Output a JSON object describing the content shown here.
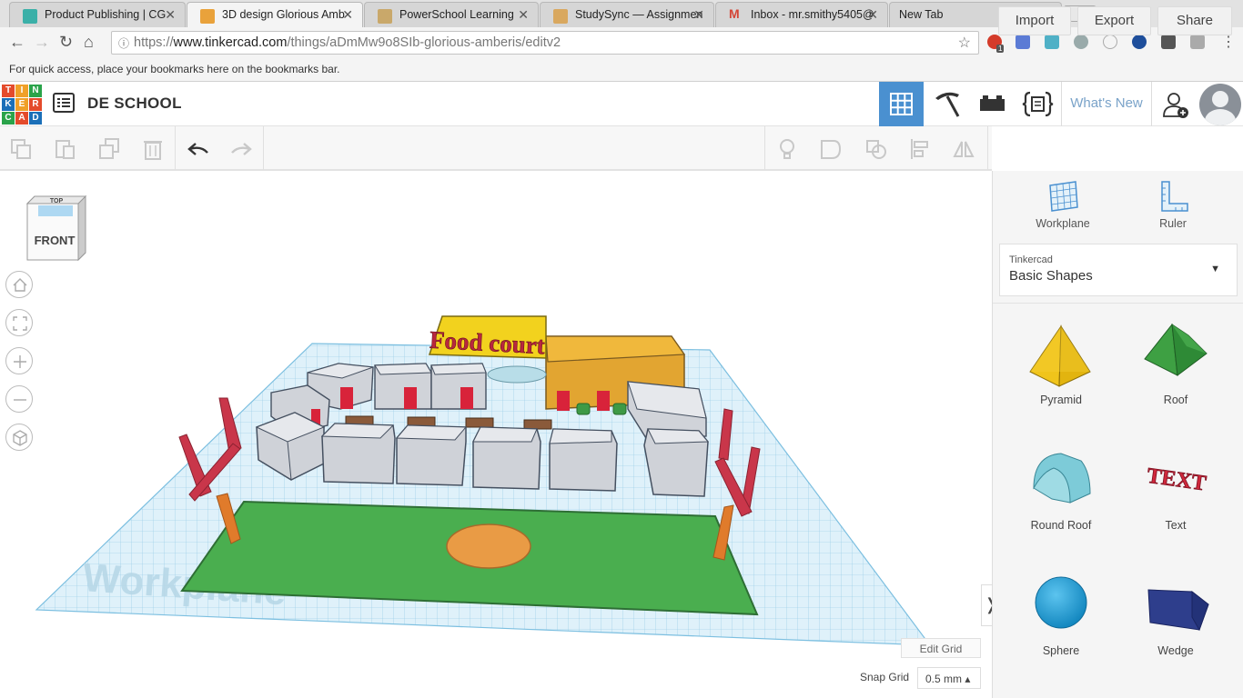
{
  "browser": {
    "tabs": [
      {
        "title": "Product Publishing | CG",
        "favicon_color": "#3bb0a8",
        "active": false
      },
      {
        "title": "3D design Glorious Amb",
        "favicon_color": "#e9a23b",
        "active": true
      },
      {
        "title": "PowerSchool Learning",
        "favicon_color": "#c9a86a",
        "active": false
      },
      {
        "title": "StudySync — Assignmen",
        "favicon_color": "#d9a85f",
        "active": false
      },
      {
        "title": "Inbox - mr.smithy5405@",
        "favicon_color": "#d44638",
        "active": false
      },
      {
        "title": "New Tab",
        "favicon_color": "",
        "active": false
      }
    ],
    "url_prefix": "https://",
    "url_host": "www.tinkercad.com",
    "url_path": "/things/aDmMw9o8SIb-glorious-amberis/editv2",
    "bookmarks_hint": "For quick access, place your bookmarks here on the bookmarks bar.",
    "extension_badge": "1"
  },
  "header": {
    "logo_letters": [
      "T",
      "I",
      "N",
      "K",
      "E",
      "R",
      "C",
      "A",
      "D"
    ],
    "logo_colors": [
      "#e44b2c",
      "#f0a028",
      "#2aa34a",
      "#1b6fb8",
      "#f0a028",
      "#e44b2c",
      "#2aa34a",
      "#e44b2c",
      "#1b6fb8"
    ],
    "project_title": "DE SCHOOL",
    "whats_new": "What's New",
    "accent": "#4a90d0"
  },
  "toolbar": {
    "import": "Import",
    "export": "Export",
    "share": "Share"
  },
  "viewcube": {
    "top": "TOP",
    "front": "FRONT"
  },
  "scene": {
    "sign_text": "Food court",
    "workplane_watermark": "Workplane"
  },
  "bottom": {
    "edit_grid": "Edit Grid",
    "snap_label": "Snap Grid",
    "snap_value": "0.5 mm ▴"
  },
  "panel": {
    "workplane": "Workplane",
    "ruler": "Ruler",
    "library_provider": "Tinkercad",
    "library_name": "Basic Shapes",
    "shapes": [
      {
        "name": "Pyramid",
        "icon": "pyramid-icon"
      },
      {
        "name": "Roof",
        "icon": "roof-icon"
      },
      {
        "name": "Round Roof",
        "icon": "round-roof-icon"
      },
      {
        "name": "Text",
        "icon": "text-shape-icon"
      },
      {
        "name": "Sphere",
        "icon": "sphere-icon"
      },
      {
        "name": "Wedge",
        "icon": "wedge-icon"
      }
    ]
  }
}
